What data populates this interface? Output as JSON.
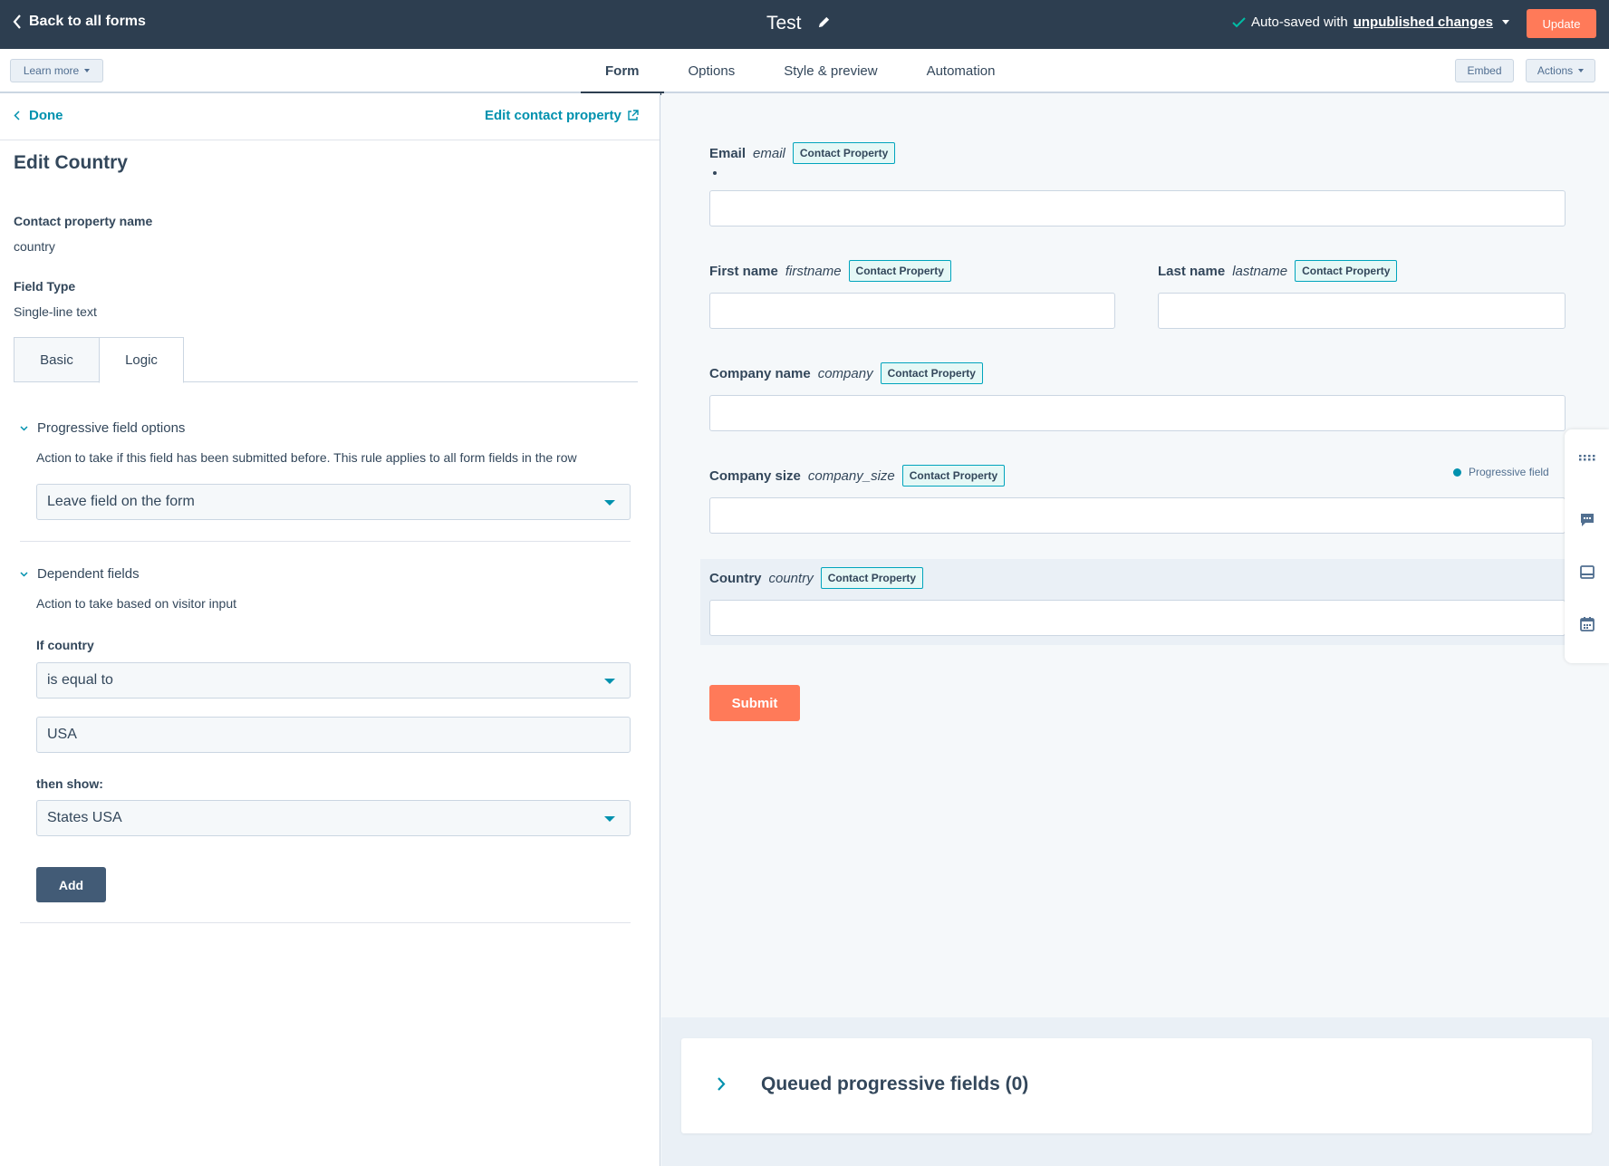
{
  "topbar": {
    "back_label": "Back to all forms",
    "form_title": "Test",
    "autosave_prefix": "Auto-saved with",
    "autosave_link": "unpublished changes",
    "update_label": "Update"
  },
  "navbar": {
    "learn_more": "Learn more",
    "tabs": [
      {
        "label": "Form",
        "active": true
      },
      {
        "label": "Options",
        "active": false
      },
      {
        "label": "Style & preview",
        "active": false
      },
      {
        "label": "Automation",
        "active": false
      }
    ],
    "embed": "Embed",
    "actions": "Actions"
  },
  "panel": {
    "done": "Done",
    "edit_property": "Edit contact property",
    "title": "Edit Country",
    "property_name_label": "Contact property name",
    "property_name_value": "country",
    "field_type_label": "Field Type",
    "field_type_value": "Single-line text",
    "tabs": [
      {
        "label": "Basic"
      },
      {
        "label": "Logic"
      }
    ],
    "progressive": {
      "heading": "Progressive field options",
      "description": "Action to take if this field has been submitted before. This rule applies to all form fields in the row",
      "selected": "Leave field on the form"
    },
    "dependent": {
      "heading": "Dependent fields",
      "description": "Action to take based on visitor input",
      "if_label": "If country",
      "operator": "is equal to",
      "value": "USA",
      "then_label": "then show:",
      "then_value": "States USA",
      "add": "Add"
    }
  },
  "preview": {
    "badge": "Contact Property",
    "fields": [
      {
        "label": "Email",
        "internal": "email"
      },
      {
        "label": "First name",
        "internal": "firstname"
      },
      {
        "label": "Last name",
        "internal": "lastname"
      },
      {
        "label": "Company name",
        "internal": "company"
      },
      {
        "label": "Company size",
        "internal": "company_size"
      },
      {
        "label": "Country",
        "internal": "country"
      }
    ],
    "progressive_field": "Progressive field",
    "submit": "Submit",
    "queued": "Queued progressive fields (0)"
  },
  "colors": {
    "topbar": "#2d3e50",
    "accent_orange": "#ff7a59",
    "link_teal": "#0091ae",
    "add_button": "#425b76"
  },
  "icons": [
    "chevron-left-icon",
    "pencil-icon",
    "check-icon",
    "external-link-icon",
    "chevron-down-icon",
    "chevron-right-icon",
    "grid-icon",
    "chat-icon",
    "window-icon",
    "calendar-icon"
  ]
}
